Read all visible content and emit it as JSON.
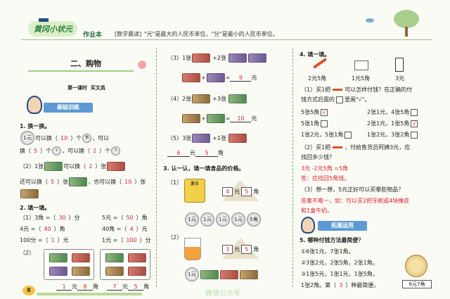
{
  "header": {
    "brand": "黄冈小状元",
    "book": "作业本",
    "morning_tag": "[数学晨读]",
    "morning_text": "\"元\"是最大的人民币单位，\"分\"是最小的人民币单位。"
  },
  "left": {
    "unit_title": "二、购物",
    "lesson_title": "第一课时",
    "lesson_name": "买文具",
    "section_banner": "基础训练",
    "q1": {
      "title": "1. 换一换。",
      "r1a": "可以换（",
      "r1a_ans": "10",
      "r1b": "）个",
      "r1c": "，可以",
      "r2a": "换（",
      "r2a_ans": "5",
      "r2b": "）个",
      "r2c": "，可以换（",
      "r2c_ans": "2",
      "r2d": "）个",
      "r3a": "（2）1张",
      "r3b": "可以换（",
      "r3b_ans": "2",
      "r3c": "）张",
      "r4a": "还可以换（",
      "r4a_ans": "5",
      "r4b": "）张",
      "r4c": "，也可以换（",
      "r4c_ans": "10",
      "r4d": "）张"
    },
    "q2": {
      "title": "2. 填一填。",
      "rows": [
        [
          "（1）3角 =（",
          "30",
          "）分",
          "5元 =（",
          "50",
          "）角"
        ],
        [
          "4元 =（",
          "40",
          "）角",
          "40角 =（",
          "4",
          "）元"
        ],
        [
          "100分 =（",
          "1",
          "）元",
          "1元 =（",
          "100",
          "）分"
        ]
      ],
      "sub2": "（2）",
      "ans_a": "1",
      "unit_a1": "元",
      "ans_b": "8",
      "unit_a2": "角",
      "ans_c": "7",
      "unit_c1": "元",
      "ans_d": "5",
      "unit_c2": "角"
    },
    "page_num": "8"
  },
  "middle": {
    "r3": {
      "label": "（3）1张",
      "ans": "9",
      "unit": "元"
    },
    "r4": {
      "label": "（4）2张",
      "ans": "10",
      "unit": "元"
    },
    "r5": {
      "label": "（5）3张",
      "ans_a": "6",
      "unit_a": "元",
      "ans_b": "5",
      "unit_b": "角"
    },
    "q3_title": "3. 认一认，填一填食品的价格。",
    "sub1": "（1）",
    "sub2": "（2）",
    "tag1": {
      "a": "4",
      "u1": "元",
      "b": "5",
      "u2": "角"
    },
    "tag2": {
      "a": "3",
      "u1": "元",
      "b": "5",
      "u2": "角"
    },
    "snack": "薯条"
  },
  "right": {
    "q4_title": "4. 填一填。",
    "prices": [
      "2元5角",
      "1元5角",
      "3元"
    ],
    "p1a": "（1）买1把",
    "p1b": "可以怎样付钱？在正确的付",
    "p1c": "钱方式后面的",
    "p1d": "里画\"√\"。",
    "opt1": "5张5角",
    "opt1_mark": "√",
    "opt2": "2张1元，4张5角",
    "opt3": "5张1角",
    "opt4": "2张1元，1张5角",
    "opt4_mark": "√",
    "opt5": "1张2元，5张1角",
    "opt6": "1张2元，3张2角",
    "p2a": "（2）买1把",
    "p2b": "，付给售货员阿姨3元，应",
    "p2c": "找回多少钱？",
    "p2_ans1": "3元 -2元5角 =5角",
    "p2_ans2": "答：应找回5角钱。",
    "p3": "（3）想一想，5元正好可以买哪些物品？",
    "p3_ans1": "答案不唯一，如：可以买2把牙刷或4块橡皮",
    "p3_ans2": "和1盒牛奶。",
    "banner2": "拓展运用",
    "q5_title": "5. 哪种付钱方法最简便？",
    "m1": "①6张1元，7张1角。",
    "m2": "②3张2元，2张5角，2张1角。",
    "m3": "③1张5元，1张1元，1张5角，",
    "m4": "1张2角。第（",
    "m4_ans": "3",
    "m4_end": "）种最简便。",
    "price_tag": "6元7角"
  },
  "watermark": "微信公众号"
}
